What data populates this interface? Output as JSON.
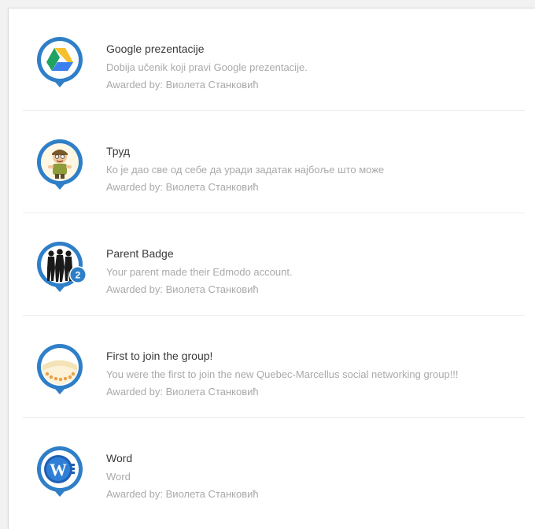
{
  "badges": [
    {
      "title": "Google prezentacije",
      "description": "Dobija učenik koji pravi Google prezentacije.",
      "awarded_by": "Awarded by: Виолета Станковић",
      "icon": "google-drive-icon"
    },
    {
      "title": "Труд",
      "description": "Ко је дао све од себе да уради задатак најбоље што може",
      "awarded_by": "Awarded by: Виолета Станковић",
      "icon": "worker-character-icon"
    },
    {
      "title": "Parent Badge",
      "description": "Your parent made their Edmodo account.",
      "awarded_by": "Awarded by: Виолета Станковић",
      "icon": "parent-silhouettes-icon",
      "count": "2"
    },
    {
      "title": "First to join the group!",
      "description": "You were the first to join the new Quebec-Marcellus social networking group!!!",
      "awarded_by": "Awarded by: Виолета Станковић",
      "icon": "ribbon-medal-icon"
    },
    {
      "title": "Word",
      "description": "Word",
      "awarded_by": "Awarded by: Виолета Станковић",
      "icon": "microsoft-word-icon"
    }
  ],
  "colors": {
    "badge_ring": "#2f7fc8",
    "title_text": "#3a3a3a",
    "muted_text": "#a9a9a9"
  }
}
